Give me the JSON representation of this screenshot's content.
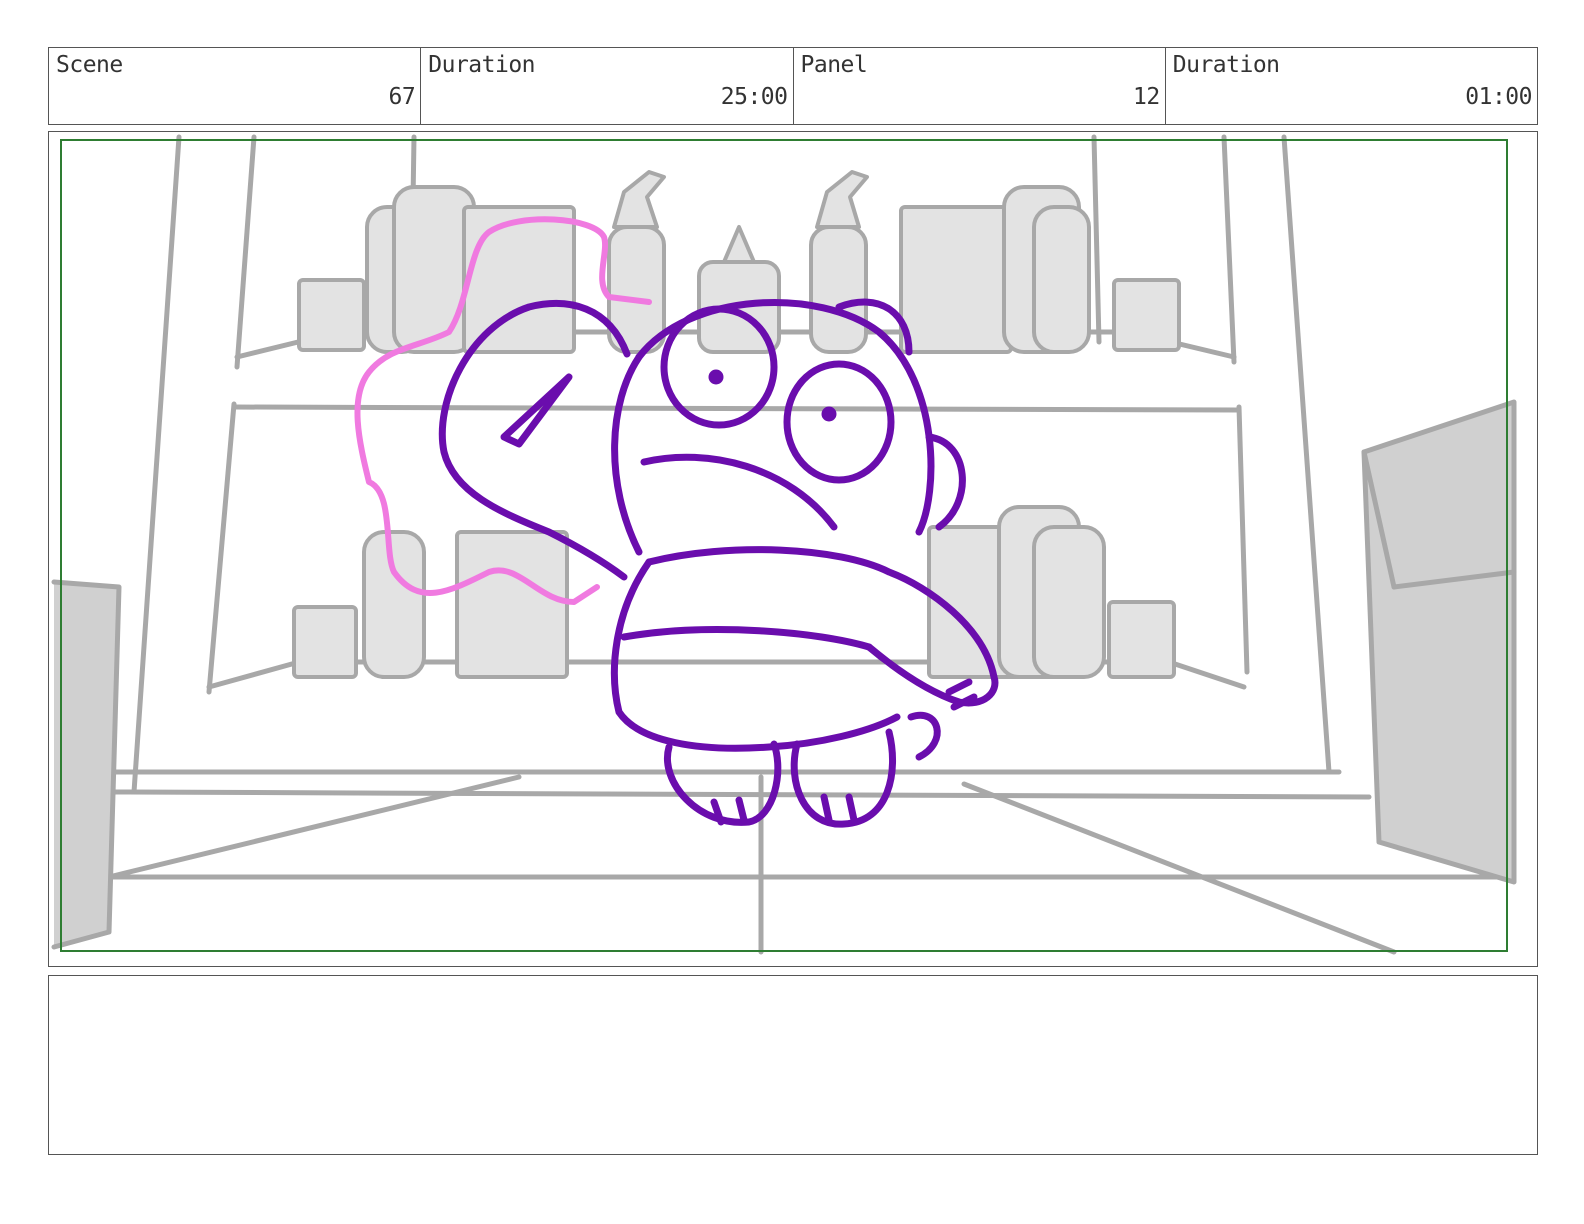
{
  "header": {
    "scene_label": "Scene",
    "scene_value": "67",
    "scene_duration_label": "Duration",
    "scene_duration_value": "25:00",
    "panel_label": "Panel",
    "panel_value": "12",
    "panel_duration_label": "Duration",
    "panel_duration_value": "01:00"
  },
  "artwork": {
    "character_color": "#6a0dad",
    "effect_color": "#f07ae0",
    "background_color": "#a8a8a8",
    "safe_frame_color": "#2e7d32"
  },
  "notes": {
    "text": ""
  }
}
